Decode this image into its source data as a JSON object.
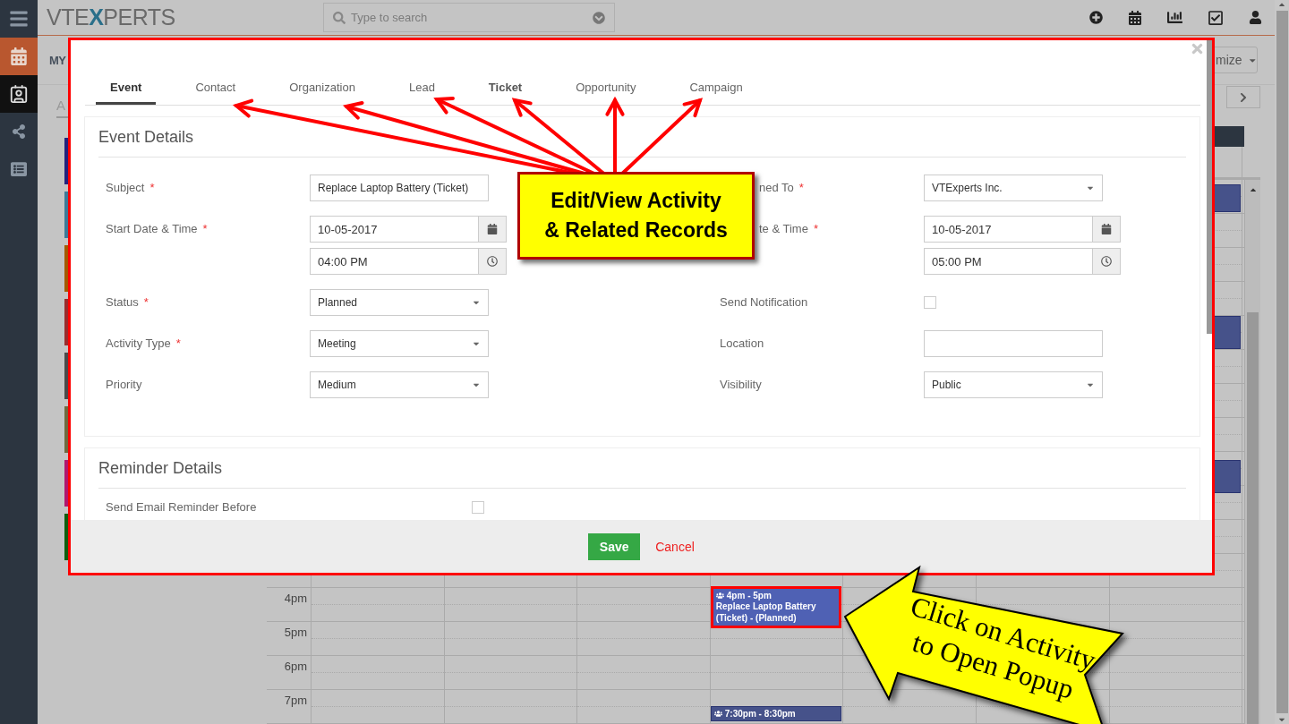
{
  "sidebar": {
    "items": [
      {
        "current": false,
        "selected": false
      },
      {
        "current": true,
        "selected": false
      },
      {
        "current": false,
        "selected": true
      },
      {
        "current": false,
        "selected": false
      },
      {
        "current": false,
        "selected": false
      }
    ]
  },
  "topbar": {
    "logo": [
      "VTE",
      "X",
      "PERTS"
    ],
    "search": {
      "placeholder": "Type to search"
    }
  },
  "page": {
    "title": "MY",
    "customize_button": "mize",
    "tab": "A"
  },
  "calendars": [
    {
      "color": "#23237e"
    },
    {
      "color": "#3d7a98"
    },
    {
      "color": "#a35a00"
    },
    {
      "color": "#9a2c2c"
    },
    {
      "color": "#4a4a4a"
    },
    {
      "color": "#6f6a40"
    },
    {
      "color": "#b0176e"
    },
    {
      "color": "#0f5f0f"
    }
  ],
  "calendar": {
    "hours": [
      "4pm",
      "5pm",
      "6pm",
      "7pm"
    ],
    "events": [
      {
        "time": "4pm - 5pm",
        "title": "Replace Laptop Battery (Ticket) - (Planned)",
        "selected": true
      },
      {
        "time": "7:30pm - 8:30pm",
        "selected": false
      }
    ]
  },
  "dialog": {
    "tabs": [
      {
        "label": "Event",
        "selected": true,
        "highlighted": false
      },
      {
        "label": "Contact",
        "selected": false,
        "highlighted": false
      },
      {
        "label": "Organization",
        "selected": false,
        "highlighted": false
      },
      {
        "label": "Lead",
        "selected": false,
        "highlighted": false
      },
      {
        "label": "Ticket",
        "selected": false,
        "highlighted": true
      },
      {
        "label": "Opportunity",
        "selected": false,
        "highlighted": false
      },
      {
        "label": "Campaign",
        "selected": false,
        "highlighted": false
      }
    ],
    "event_details": {
      "title": "Event Details",
      "rows": [
        {
          "fields": [
            {
              "label": "Subject",
              "asterisk": "*",
              "kind": "text",
              "value": "Replace Laptop Battery (Ticket)"
            },
            {
              "label": "ned To",
              "asterisk": "*",
              "kind": "select",
              "value": "VTExperts Inc."
            }
          ]
        },
        {
          "fields": [
            {
              "label": "Start Date & Time",
              "asterisk": "*",
              "kind": "datetime",
              "date": "10-05-2017",
              "time": "04:00 PM"
            },
            {
              "label": "te & Time",
              "asterisk": "*",
              "kind": "datetime",
              "date": "10-05-2017",
              "time": "05:00 PM"
            }
          ]
        },
        {
          "fields": [
            {
              "label": "Status",
              "asterisk": "*",
              "kind": "select",
              "value": "Planned"
            },
            {
              "label": "Send Notification",
              "kind": "checkbox",
              "checked": false
            }
          ]
        },
        {
          "fields": [
            {
              "label": "Activity Type",
              "asterisk": "*",
              "kind": "select",
              "value": "Meeting"
            },
            {
              "label": "Location",
              "kind": "text"
            }
          ]
        },
        {
          "fields": [
            {
              "label": "Priority",
              "kind": "select",
              "value": "Medium"
            },
            {
              "label": "Visibility",
              "kind": "select",
              "value": "Public"
            }
          ]
        }
      ]
    },
    "reminder_details": {
      "title": "Reminder Details",
      "fields": [
        {
          "label": "Send Email Reminder Before",
          "kind": "checkbox",
          "checked": false
        }
      ]
    },
    "buttons": {
      "save": "Save",
      "cancel": "Cancel"
    }
  },
  "annotations": {
    "callout": "Edit/View Activity\n& Related Records",
    "pointer": "Click on Activity\nto Open Popup"
  }
}
